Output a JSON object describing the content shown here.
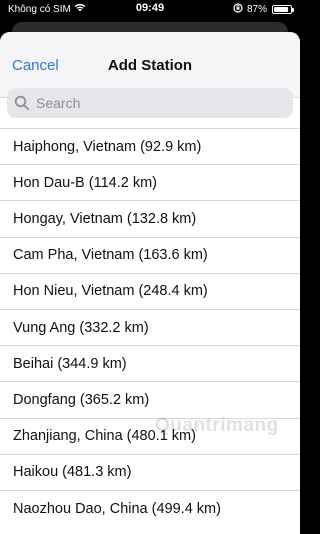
{
  "status_bar": {
    "carrier": "Không có SIM",
    "time": "09:49",
    "battery": "87%",
    "battery_level": 0.87
  },
  "header": {
    "cancel_label": "Cancel",
    "title": "Add Station"
  },
  "search": {
    "placeholder": "Search",
    "value": ""
  },
  "stations": [
    {
      "label": "Haiphong, Vietnam (92.9 km)"
    },
    {
      "label": "Hon Dau-B (114.2 km)"
    },
    {
      "label": "Hongay, Vietnam (132.8 km)"
    },
    {
      "label": "Cam Pha, Vietnam (163.6 km)"
    },
    {
      "label": "Hon Nieu, Vietnam (248.4 km)"
    },
    {
      "label": "Vung Ang (332.2 km)"
    },
    {
      "label": "Beihai (344.9 km)"
    },
    {
      "label": "Dongfang (365.2 km)"
    },
    {
      "label": "Zhanjiang, China (480.1 km)"
    },
    {
      "label": "Haikou (481.3 km)"
    },
    {
      "label": "Naozhou Dao, China (499.4 km)"
    }
  ],
  "watermark": "Quantrimang",
  "colors": {
    "accent": "#2d7bd5",
    "sheet_background": "#ffffff",
    "nav_background": "#f5f5f7"
  }
}
